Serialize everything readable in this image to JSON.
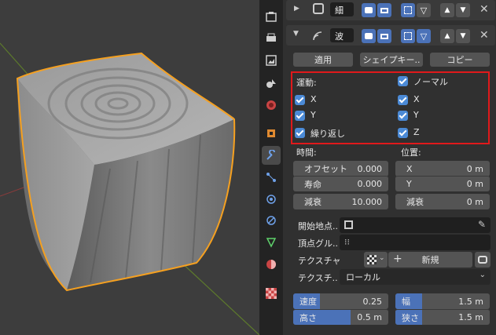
{
  "modifiers": [
    {
      "name": "細"
    },
    {
      "name": "波"
    }
  ],
  "wave": {
    "apply_label": "適用",
    "shapekey_label": "シェイプキー..",
    "copy_label": "コピー",
    "motion_label": "運動:",
    "motion_x": "X",
    "motion_y": "Y",
    "cyclic_label": "繰り返し",
    "normal_label": "ノーマル",
    "normal_x": "X",
    "normal_y": "Y",
    "normal_z": "Z",
    "time_label": "時間:",
    "offset_label": "オフセット",
    "offset_value": "0.000",
    "life_label": "寿命",
    "life_value": "0.000",
    "damping_label": "減衰",
    "damping_value": "10.000",
    "position_label": "位置:",
    "pos_x_label": "X",
    "pos_x_value": "0 m",
    "pos_y_label": "Y",
    "pos_y_value": "0 m",
    "falloff_label": "減衰",
    "falloff_value": "0 m",
    "start_pos_label": "開始地点..",
    "vertex_group_label": "頂点グル..",
    "texture_label": "テクスチャ",
    "new_label": "新規",
    "texture_coords_label": "テクスチ..",
    "texture_coords_value": "ローカル",
    "speed_label": "速度",
    "speed_value": "0.25",
    "speed_fraction": 0.28,
    "height_label": "高さ",
    "height_value": "0.5 m",
    "height_fraction": 0.6,
    "width_label": "幅",
    "width_value": "1.5 m",
    "width_fraction": 0.28,
    "narrowness_label": "狭さ",
    "narrowness_value": "1.5 m",
    "narrowness_fraction": 0.28
  },
  "colors": {
    "accent": "#4b8ad6",
    "highlight_box": "#e0191b",
    "selection_outline": "#f5a020"
  }
}
